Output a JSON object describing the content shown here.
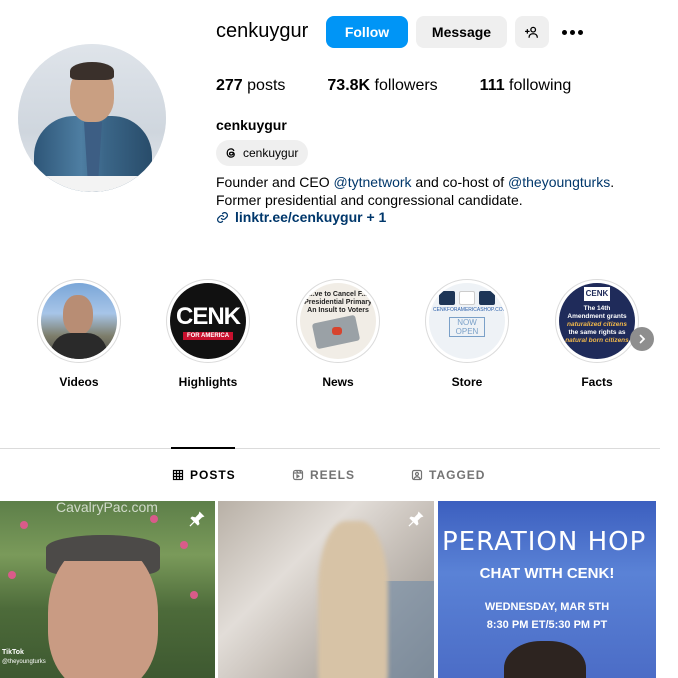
{
  "profile": {
    "username": "cenkuygur",
    "full_name": "cenkuygur",
    "threads_handle": "cenkuygur",
    "bio_line1_prefix": "Founder and CEO ",
    "bio_mention1": "@tytnetwork",
    "bio_line1_middle": " and co-host of ",
    "bio_mention2": "@theyoungturks",
    "bio_line1_suffix": ".",
    "bio_line2": "Former presidential and congressional candidate.",
    "link_text": "linktr.ee/cenkuygur + 1"
  },
  "actions": {
    "follow_label": "Follow",
    "message_label": "Message"
  },
  "stats": {
    "posts_count": "277",
    "posts_label": " posts",
    "followers_count": "73.8K",
    "followers_label": " followers",
    "following_count": "111",
    "following_label": " following"
  },
  "highlights": [
    {
      "label": "Videos"
    },
    {
      "label": "Highlights",
      "logo_text": "CENK",
      "logo_sub": "FOR AMERICA"
    },
    {
      "label": "News",
      "thumb_text": "...ve to Cancel F... Presidential Primary An Insult to Voters"
    },
    {
      "label": "Store",
      "thumb_text": "CENKFORAMERICASHOP.COM",
      "thumb_badge": "NOW OPEN"
    },
    {
      "label": "Facts",
      "thumb_logo": "CENK",
      "thumb_text_1": "The 14th Amendment grants ",
      "thumb_em_1": "naturalized citizens",
      "thumb_text_2": " the same rights as ",
      "thumb_em_2": "natural born citizens"
    }
  ],
  "tabs": {
    "posts": "POSTS",
    "reels": "REELS",
    "tagged": "TAGGED"
  },
  "posts": {
    "post1_watermark": "CavalryPac.com",
    "post1_tiktok": "TikTok",
    "post1_handle": "@theyoungturks",
    "post3_title": "PERATION HOP",
    "post3_subtitle": "CHAT WITH CENK!",
    "post3_date": "WEDNESDAY, MAR 5TH",
    "post3_time": "8:30 PM ET/5:30 PM PT"
  },
  "colors": {
    "accent": "#0095f6",
    "link": "#00376b",
    "muted": "#737373"
  }
}
